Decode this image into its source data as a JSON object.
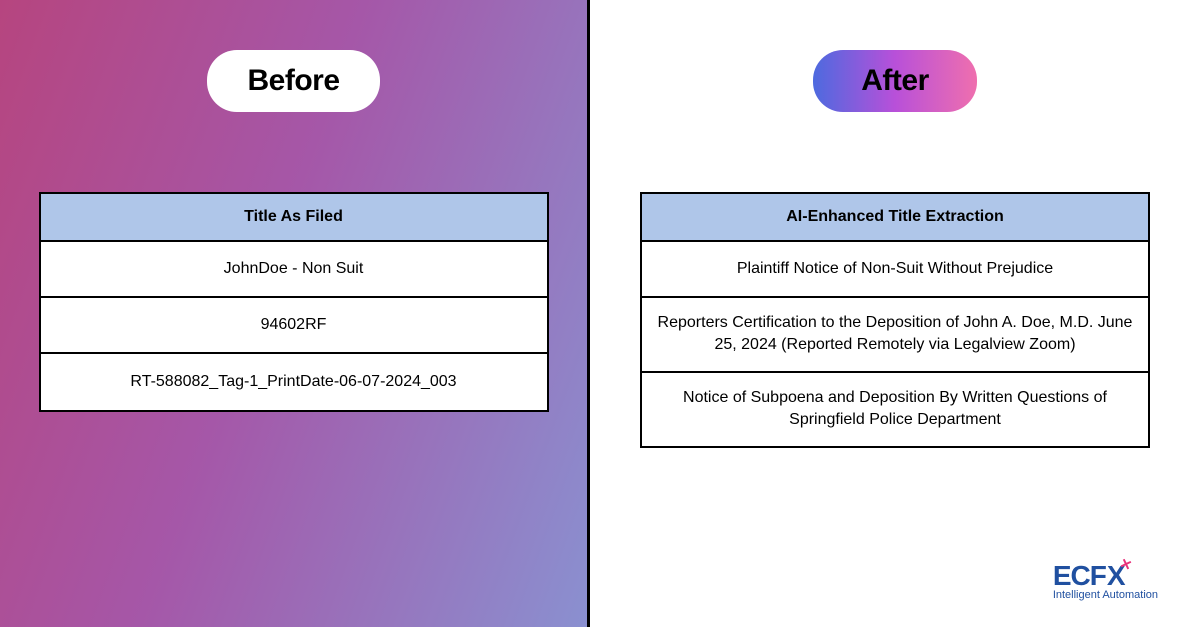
{
  "before": {
    "pill_label": "Before",
    "table_header": "Title As Filed",
    "rows": [
      "JohnDoe - Non Suit",
      "94602RF",
      "RT-588082_Tag-1_PrintDate-06-07-2024_003"
    ]
  },
  "after": {
    "pill_label": "After",
    "table_header": "AI-Enhanced Title Extraction",
    "rows": [
      "Plaintiff Notice of Non-Suit Without Prejudice",
      "Reporters Certification to the Deposition of John A. Doe, M.D. June 25, 2024 (Reported Remotely via Legalview Zoom)",
      "Notice of Subpoena and Deposition By Written Questions of Springfield Police Department"
    ]
  },
  "logo": {
    "brand": "ECF",
    "brand_x": "X",
    "tagline": "Intelligent Automation"
  }
}
